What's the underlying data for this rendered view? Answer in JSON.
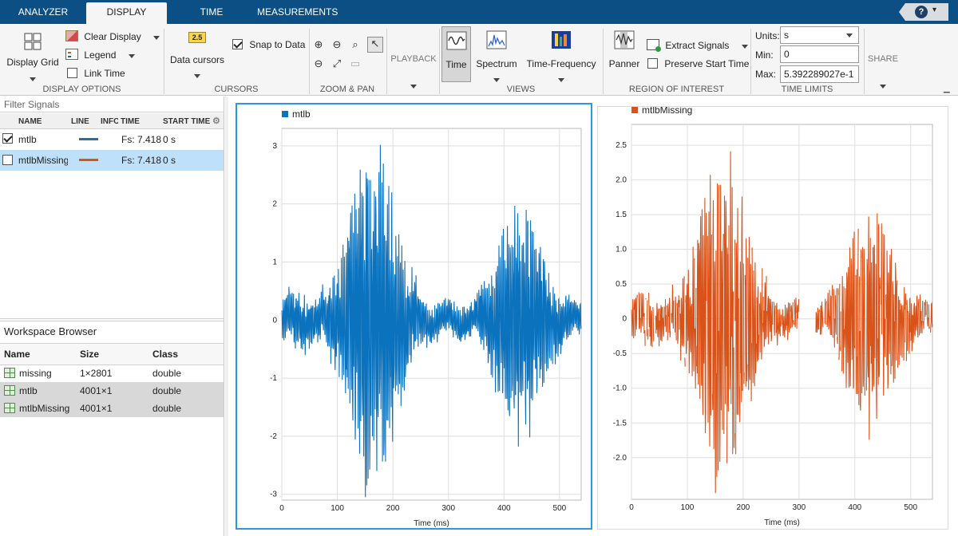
{
  "tabs": [
    "ANALYZER",
    "DISPLAY",
    "TIME",
    "MEASUREMENTS"
  ],
  "display_options": {
    "display_grid": "Display Grid",
    "clear_display": "Clear Display",
    "legend": "Legend",
    "link_time": "Link Time",
    "label": "DISPLAY OPTIONS"
  },
  "cursors": {
    "icon_text": "2.5",
    "data_cursors": "Data cursors",
    "snap_to_data": "Snap to Data",
    "label": "CURSORS"
  },
  "zoom_pan": {
    "label": "ZOOM & PAN"
  },
  "playback": {
    "label": "PLAYBACK"
  },
  "views": {
    "time": "Time",
    "spectrum": "Spectrum",
    "time_frequency": "Time-Frequency",
    "label": "VIEWS"
  },
  "roi": {
    "panner": "Panner",
    "extract_signals": "Extract Signals",
    "preserve_start_time": "Preserve Start Time",
    "label": "REGION OF INTEREST"
  },
  "time_limits": {
    "units_label": "Units:",
    "units_value": "s",
    "min_label": "Min:",
    "min_value": "0",
    "max_label": "Max:",
    "max_value": "5.392289027e-1",
    "label": "TIME LIMITS"
  },
  "share": {
    "label": "SHARE"
  },
  "signals": {
    "filter_placeholder": "Filter Signals",
    "columns": [
      "NAME",
      "LINE",
      "INFO",
      "TIME",
      "START TIME"
    ],
    "rows": [
      {
        "name": "mtlb",
        "time": "Fs: 7.418",
        "start": "0 s",
        "color": "#1f6fb5",
        "checked": true
      },
      {
        "name": "mtlbMissing",
        "time": "Fs: 7.418",
        "start": "0 s",
        "color": "#d95319",
        "checked": false
      }
    ]
  },
  "workspace": {
    "title": "Workspace Browser",
    "columns": [
      "Name",
      "Size",
      "Class"
    ],
    "rows": [
      {
        "name": "missing",
        "size": "1×2801",
        "class": "double"
      },
      {
        "name": "mtlb",
        "size": "4001×1",
        "class": "double"
      },
      {
        "name": "mtlbMissing",
        "size": "4001×1",
        "class": "double"
      }
    ]
  },
  "chart_data": [
    {
      "type": "line",
      "series": [
        {
          "name": "mtlb",
          "color": "#0b72bd"
        }
      ],
      "xlabel": "Time (ms)",
      "ylabel": "",
      "xlim": [
        0,
        539
      ],
      "ylim": [
        -3.1,
        3.3
      ],
      "xticks": [
        0,
        100,
        200,
        300,
        400,
        500
      ],
      "yticks": [
        -3,
        -2,
        -1,
        0,
        1,
        2,
        3
      ],
      "ytick_labels": [
        "-3",
        "-2",
        "-1",
        "0",
        "1",
        "2",
        "3"
      ],
      "grid": true,
      "legend": "top-left"
    },
    {
      "type": "line",
      "series": [
        {
          "name": "mtlbMissing",
          "color": "#d95319"
        }
      ],
      "xlabel": "Time (ms)",
      "ylabel": "",
      "xlim": [
        0,
        539
      ],
      "ylim": [
        -2.6,
        2.8
      ],
      "xticks": [
        0,
        100,
        200,
        300,
        400,
        500
      ],
      "yticks": [
        -2,
        -1.5,
        -1,
        -0.5,
        0,
        0.5,
        1,
        1.5,
        2,
        2.5
      ],
      "ytick_labels": [
        "-2.0",
        "-1.5",
        "-1.0",
        "-0.5",
        "0",
        "0.5",
        "1.0",
        "1.5",
        "2.0",
        "2.5"
      ],
      "grid": true,
      "legend": "top-left"
    }
  ]
}
